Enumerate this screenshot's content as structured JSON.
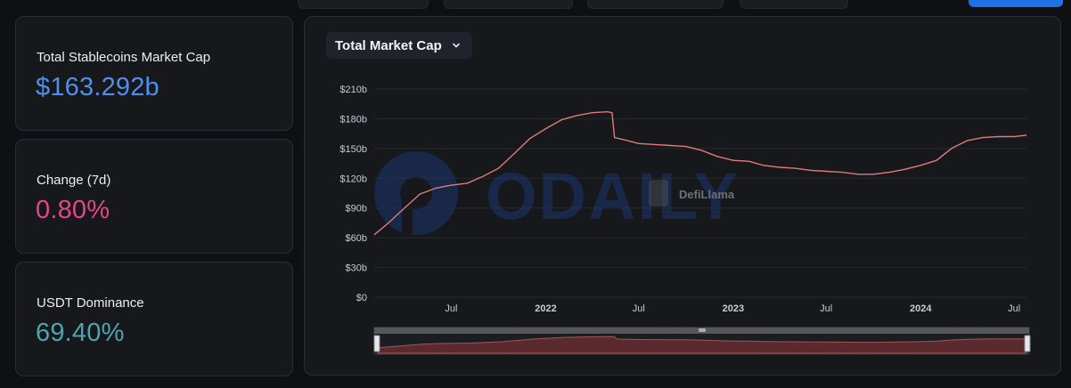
{
  "cards": [
    {
      "label": "Total Stablecoins Market Cap",
      "value": "$163.292b",
      "color": "#4f8fea"
    },
    {
      "label": "Change (7d)",
      "value": "0.80%",
      "color": "#e44688"
    },
    {
      "label": "USDT Dominance",
      "value": "69.40%",
      "color": "#4fa4ad"
    }
  ],
  "dropdown": {
    "label": "Total Market Cap",
    "icon": "chevron-down-icon"
  },
  "watermarks": {
    "odaily": "ODAILY",
    "defillama": "DefiLlama"
  },
  "colors": {
    "line": "#e07a7a",
    "area": "#5a2a2e",
    "grid": "#26282d",
    "axis_text": "#c9cbd0"
  },
  "chart_data": {
    "type": "line",
    "title": "Total Market Cap",
    "xlabel": "",
    "ylabel": "",
    "ylim": [
      0,
      210
    ],
    "y_unit": "b",
    "y_ticks": [
      "$0",
      "$30b",
      "$60b",
      "$90b",
      "$120b",
      "$150b",
      "$180b",
      "$210b"
    ],
    "x_ticks": [
      {
        "date": "2021-07-01",
        "label": "Jul"
      },
      {
        "date": "2022-01-01",
        "label": "2022"
      },
      {
        "date": "2022-07-01",
        "label": "Jul"
      },
      {
        "date": "2023-01-01",
        "label": "2023"
      },
      {
        "date": "2023-07-01",
        "label": "Jul"
      },
      {
        "date": "2024-01-01",
        "label": "2024"
      },
      {
        "date": "2024-07-01",
        "label": "Jul"
      }
    ],
    "x_range": [
      "2021-02-01",
      "2024-07-25"
    ],
    "grid": true,
    "legend": "none",
    "series": [
      {
        "points": [
          [
            "2021-02-01",
            63
          ],
          [
            "2021-03-01",
            75
          ],
          [
            "2021-04-01",
            90
          ],
          [
            "2021-05-01",
            104
          ],
          [
            "2021-06-01",
            110
          ],
          [
            "2021-07-01",
            113
          ],
          [
            "2021-08-01",
            115
          ],
          [
            "2021-09-01",
            122
          ],
          [
            "2021-10-01",
            130
          ],
          [
            "2021-11-01",
            145
          ],
          [
            "2021-12-01",
            160
          ],
          [
            "2022-01-01",
            170
          ],
          [
            "2022-02-01",
            179
          ],
          [
            "2022-03-01",
            183
          ],
          [
            "2022-04-01",
            186
          ],
          [
            "2022-05-01",
            187
          ],
          [
            "2022-05-10",
            186
          ],
          [
            "2022-05-15",
            161
          ],
          [
            "2022-06-01",
            159
          ],
          [
            "2022-07-01",
            155
          ],
          [
            "2022-08-01",
            154
          ],
          [
            "2022-09-01",
            153
          ],
          [
            "2022-10-01",
            152
          ],
          [
            "2022-11-01",
            148
          ],
          [
            "2022-12-01",
            142
          ],
          [
            "2023-01-01",
            138
          ],
          [
            "2023-02-01",
            137
          ],
          [
            "2023-03-01",
            133
          ],
          [
            "2023-04-01",
            131
          ],
          [
            "2023-05-01",
            130
          ],
          [
            "2023-06-01",
            128
          ],
          [
            "2023-07-01",
            127
          ],
          [
            "2023-08-01",
            126
          ],
          [
            "2023-09-01",
            124
          ],
          [
            "2023-10-01",
            124
          ],
          [
            "2023-11-01",
            126
          ],
          [
            "2023-12-01",
            129
          ],
          [
            "2024-01-01",
            133
          ],
          [
            "2024-02-01",
            138
          ],
          [
            "2024-03-01",
            150
          ],
          [
            "2024-04-01",
            158
          ],
          [
            "2024-05-01",
            161
          ],
          [
            "2024-06-01",
            162
          ],
          [
            "2024-07-01",
            162
          ],
          [
            "2024-07-25",
            163.3
          ]
        ]
      }
    ]
  }
}
